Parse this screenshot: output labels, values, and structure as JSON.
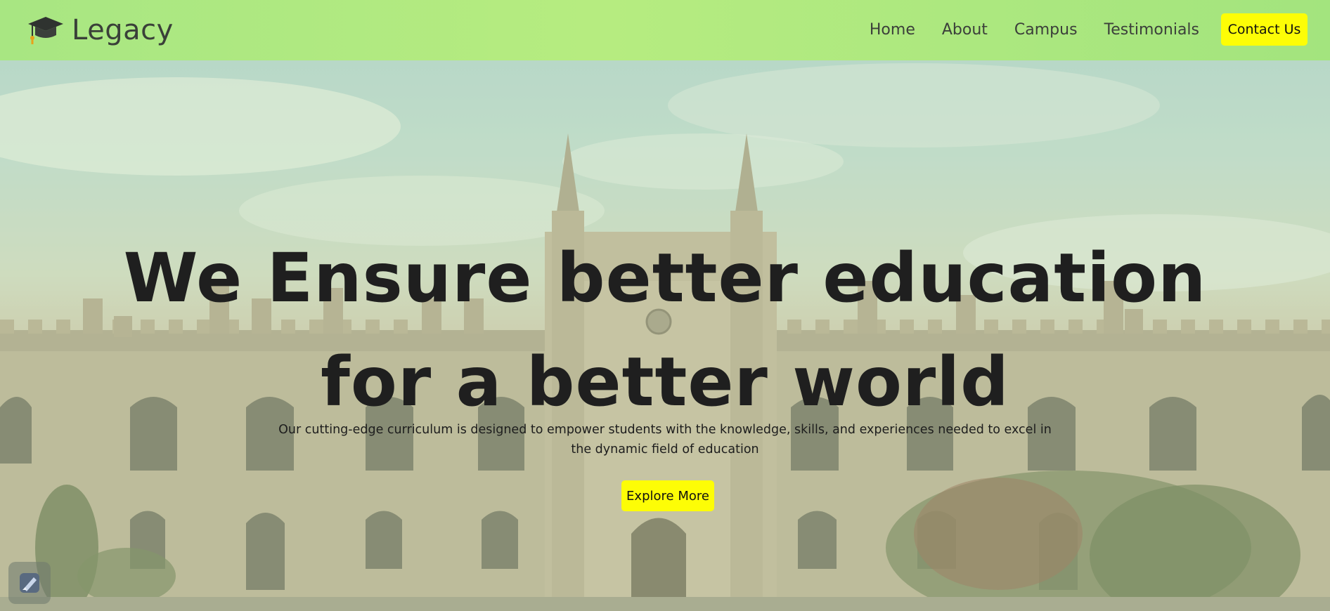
{
  "brand": {
    "name": "Legacy",
    "icon": "graduation-cap-icon"
  },
  "nav": {
    "links": [
      {
        "label": "Home"
      },
      {
        "label": "About"
      },
      {
        "label": "Campus"
      },
      {
        "label": "Testimonials"
      }
    ],
    "contact_label": "Contact Us"
  },
  "hero": {
    "headline_line1": "We Ensure better education",
    "headline_line2": "for a better world",
    "subtext": "Our cutting-edge curriculum is designed to empower students with the knowledge, skills, and experiences needed to excel in the dynamic field of education",
    "cta_label": "Explore More"
  },
  "widget": {
    "icon": "pen-sparkle-icon"
  },
  "colors": {
    "navbar_bg": "#b6ec80",
    "button_bg": "#fdfd06",
    "text_dark": "#1f1f1f"
  }
}
